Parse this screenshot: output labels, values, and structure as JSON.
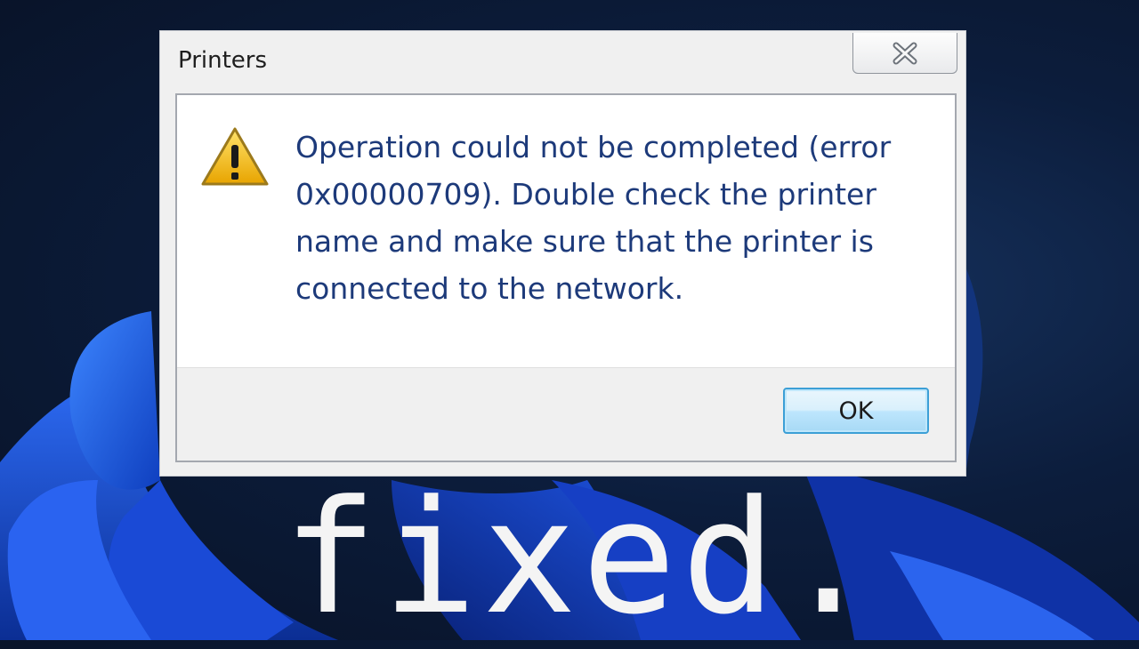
{
  "dialog": {
    "title": "Printers",
    "message": "Operation could not be completed (error 0x00000709). Double check the printer name and make sure that the printer is connected to the network.",
    "ok_label": "OK",
    "close_icon": "close-icon",
    "warning_icon": "warning-icon"
  },
  "caption": "fixed.",
  "colors": {
    "message_text": "#1d3a7a",
    "ok_border": "#3c9fd6",
    "wallpaper_blue": "#1f5bf0",
    "background": "#0c1d3c"
  }
}
